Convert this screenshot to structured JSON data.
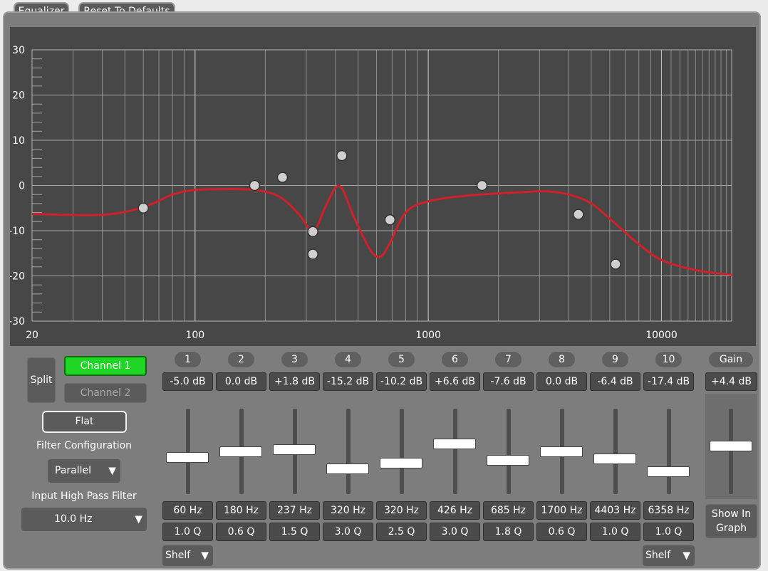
{
  "top_buttons": {
    "equalizer": "Equalizer",
    "reset": "Reset To Defaults"
  },
  "graph": {
    "y_ticks": [
      "30",
      "20",
      "10",
      "0",
      "-10",
      "-20",
      "-30"
    ],
    "x_ticks": [
      "20",
      "100",
      "1000",
      "10000"
    ],
    "ylim": [
      -30,
      30
    ],
    "xlim": [
      20,
      20000
    ],
    "curve_color": "#d0202a",
    "points": [
      {
        "f": 60,
        "db": -5.0
      },
      {
        "f": 180,
        "db": 0.0
      },
      {
        "f": 237,
        "db": 1.8
      },
      {
        "f": 320,
        "db": -15.2
      },
      {
        "f": 320,
        "db": -10.2
      },
      {
        "f": 426,
        "db": 6.6
      },
      {
        "f": 685,
        "db": -7.6
      },
      {
        "f": 1700,
        "db": 0.0
      },
      {
        "f": 4403,
        "db": -6.4
      },
      {
        "f": 6358,
        "db": -17.4
      }
    ],
    "curve": [
      [
        20,
        -6.3
      ],
      [
        40,
        -6.5
      ],
      [
        60,
        -4.8
      ],
      [
        80,
        -2
      ],
      [
        100,
        -1
      ],
      [
        130,
        -0.8
      ],
      [
        180,
        -1
      ],
      [
        230,
        -2.5
      ],
      [
        280,
        -6.5
      ],
      [
        320,
        -10.2
      ],
      [
        360,
        -5
      ],
      [
        400,
        -0.5
      ],
      [
        430,
        -1
      ],
      [
        480,
        -7
      ],
      [
        560,
        -14
      ],
      [
        620,
        -15.8
      ],
      [
        680,
        -13
      ],
      [
        800,
        -6
      ],
      [
        1000,
        -3.5
      ],
      [
        1500,
        -2.2
      ],
      [
        2500,
        -1.5
      ],
      [
        3200,
        -1.3
      ],
      [
        4000,
        -2
      ],
      [
        5000,
        -4
      ],
      [
        6358,
        -8.5
      ],
      [
        8000,
        -13
      ],
      [
        10000,
        -16.5
      ],
      [
        14000,
        -18.7
      ],
      [
        20000,
        -19.8
      ]
    ]
  },
  "channels": {
    "split": "Split",
    "ch1": "Channel 1",
    "ch2": "Channel 2",
    "active_color": "#1fd626"
  },
  "flat": "Flat",
  "filter_config": {
    "label": "Filter Configuration",
    "value": "Parallel"
  },
  "hpf": {
    "label": "Input High Pass Filter",
    "value": "10.0 Hz"
  },
  "bands": [
    {
      "n": "1",
      "db": "-5.0 dB",
      "freq": "60 Hz",
      "q": "1.0 Q",
      "level": -5.0
    },
    {
      "n": "2",
      "db": "0.0 dB",
      "freq": "180 Hz",
      "q": "0.6 Q",
      "level": 0.0
    },
    {
      "n": "3",
      "db": "+1.8 dB",
      "freq": "237 Hz",
      "q": "1.5 Q",
      "level": 1.8
    },
    {
      "n": "4",
      "db": "-15.2 dB",
      "freq": "320 Hz",
      "q": "3.0 Q",
      "level": -15.2
    },
    {
      "n": "5",
      "db": "-10.2 dB",
      "freq": "320 Hz",
      "q": "2.5 Q",
      "level": -10.2
    },
    {
      "n": "6",
      "db": "+6.6 dB",
      "freq": "426 Hz",
      "q": "3.0 Q",
      "level": 6.6
    },
    {
      "n": "7",
      "db": "-7.6 dB",
      "freq": "685 Hz",
      "q": "1.8 Q",
      "level": -7.6
    },
    {
      "n": "8",
      "db": "0.0 dB",
      "freq": "1700 Hz",
      "q": "0.6 Q",
      "level": 0.0
    },
    {
      "n": "9",
      "db": "-6.4 dB",
      "freq": "4403 Hz",
      "q": "1.0 Q",
      "level": -6.4
    },
    {
      "n": "10",
      "db": "-17.4 dB",
      "freq": "6358 Hz",
      "q": "1.0 Q",
      "level": -17.4
    }
  ],
  "shelf": {
    "left": "Shelf",
    "right": "Shelf"
  },
  "gain": {
    "label": "Gain",
    "value": "+4.4 dB",
    "level": 4.4,
    "show_in_graph": "Show In Graph"
  }
}
